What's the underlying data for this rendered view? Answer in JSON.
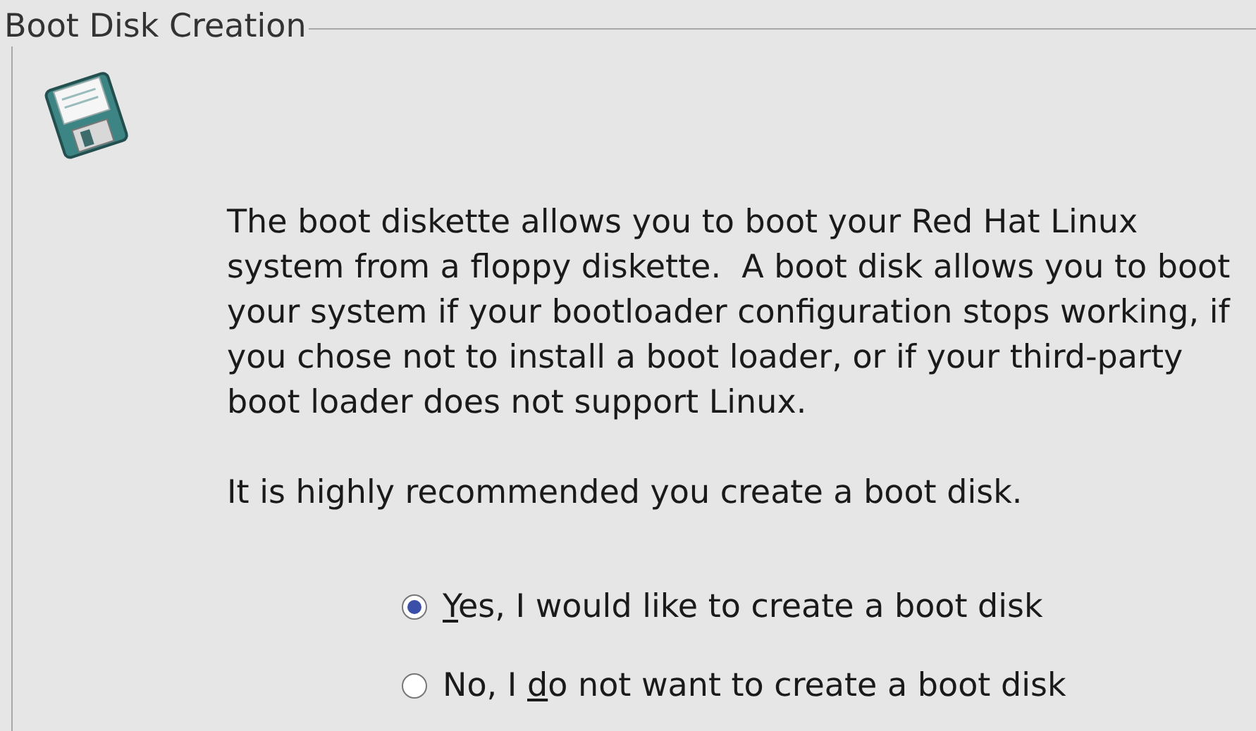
{
  "frame": {
    "title": "Boot Disk Creation"
  },
  "description": "The boot diskette allows you to boot your Red Hat Linux system from a floppy diskette.  A boot disk allows you to boot your system if your bootloader configuration stops working, if you chose not to install a boot loader, or if your third-party boot loader does not support Linux.",
  "recommendation": "It is highly recommended you create a boot disk.",
  "options": [
    {
      "label_parts": [
        {
          "text": "Y",
          "underlined": true
        },
        {
          "text": "es, I would like to create a boot disk",
          "underlined": false
        }
      ],
      "selected": true
    },
    {
      "label_parts": [
        {
          "text": "No, I ",
          "underlined": false
        },
        {
          "text": "d",
          "underlined": true
        },
        {
          "text": "o not want to create a boot disk",
          "underlined": false
        }
      ],
      "selected": false
    }
  ]
}
